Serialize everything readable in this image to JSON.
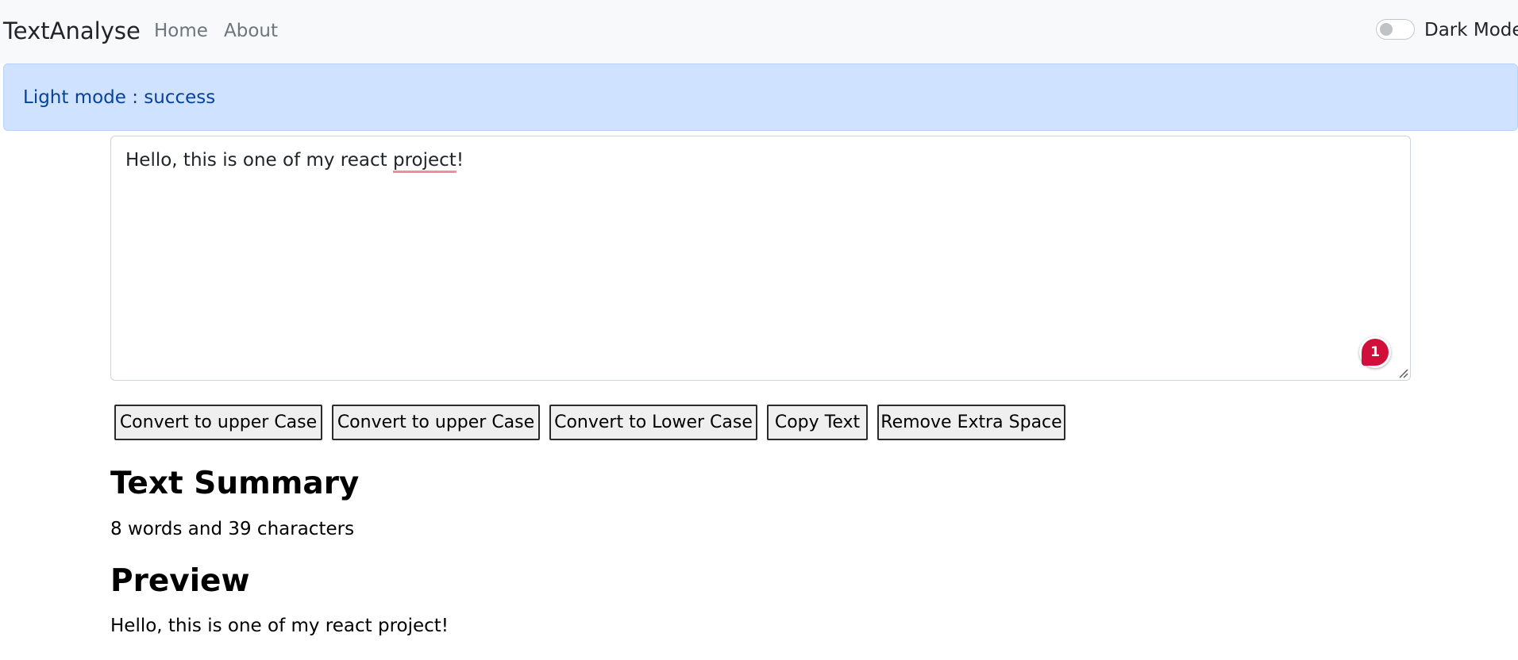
{
  "navbar": {
    "brand": "TextAnalyse",
    "links": [
      "Home",
      "About"
    ],
    "dark_mode_label": "Dark Mode",
    "dark_mode_enabled": false
  },
  "alert": {
    "text": "Light mode : success",
    "color": "#cfe2ff"
  },
  "textarea": {
    "value_before": "Hello, this is one of my react ",
    "value_flagged": "project",
    "value_after": "!",
    "grammar_issue_count": "1"
  },
  "buttons": [
    "Convert to upper Case",
    "Convert to upper Case",
    "Convert to Lower Case",
    "Copy Text",
    "Remove Extra Space"
  ],
  "summary": {
    "heading": "Text Summary",
    "text": "8 words and 39 characters"
  },
  "preview": {
    "heading": "Preview",
    "text": "Hello, this is one of my react project!"
  },
  "icons": {
    "grammar_badge": "grammar-check-icon",
    "resize": "resize-grip-icon"
  }
}
